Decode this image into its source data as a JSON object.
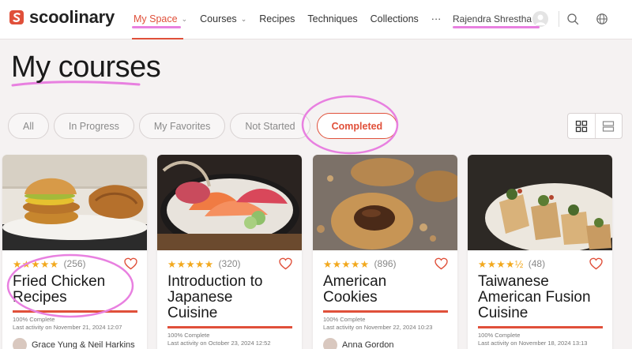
{
  "header": {
    "logo_text": "scoolinary",
    "nav": [
      {
        "label": "My Space",
        "has_dropdown": true,
        "active": true
      },
      {
        "label": "Courses",
        "has_dropdown": true,
        "active": false
      },
      {
        "label": "Recipes",
        "has_dropdown": false,
        "active": false
      },
      {
        "label": "Techniques",
        "has_dropdown": false,
        "active": false
      },
      {
        "label": "Collections",
        "has_dropdown": false,
        "active": false
      },
      {
        "label": "···",
        "has_dropdown": false,
        "active": false
      }
    ],
    "user_name": "Rajendra Shrestha",
    "icons": [
      "user-avatar-icon",
      "search-icon",
      "globe-icon"
    ]
  },
  "page_title": "My courses",
  "filters": [
    {
      "label": "All",
      "active": false
    },
    {
      "label": "In Progress",
      "active": false
    },
    {
      "label": "My Favorites",
      "active": false
    },
    {
      "label": "Not Started",
      "active": false
    },
    {
      "label": "Completed",
      "active": true
    }
  ],
  "view_toggle": [
    "grid-view-icon",
    "list-view-icon"
  ],
  "cards": [
    {
      "stars": "★★★★★",
      "rating": 5,
      "reviews": "(256)",
      "title_lines": [
        "Fried Chicken",
        "Recipes"
      ],
      "progress": 1.0,
      "complete": "100% Complete",
      "last_activity": "Last activity on November 21, 2024 12:07",
      "author": "Grace Yung & Neil Harkins"
    },
    {
      "stars": "★★★★★",
      "rating": 5,
      "reviews": "(320)",
      "title_lines": [
        "Introduction to",
        "Japanese",
        "Cuisine"
      ],
      "progress": 1.0,
      "complete": "100% Complete",
      "last_activity": "Last activity on October 23, 2024 12:52",
      "author": ""
    },
    {
      "stars": "★★★★★",
      "rating": 5,
      "reviews": "(896)",
      "title_lines": [
        "American",
        "Cookies"
      ],
      "progress": 1.0,
      "complete": "100% Complete",
      "last_activity": "Last activity on November 22, 2024 10:23",
      "author": "Anna Gordon"
    },
    {
      "stars": "★★★★½",
      "rating": 4.5,
      "reviews": "(48)",
      "title_lines": [
        "Taiwanese",
        "American Fusion",
        "Cuisine"
      ],
      "progress": 1.0,
      "complete": "100% Complete",
      "last_activity": "Last activity on November 18, 2024 13:13",
      "author": ""
    }
  ],
  "colors": {
    "accent": "#e0503a",
    "star": "#f2a81d",
    "annotation": "#e880e0",
    "background": "#f5f2f2"
  }
}
